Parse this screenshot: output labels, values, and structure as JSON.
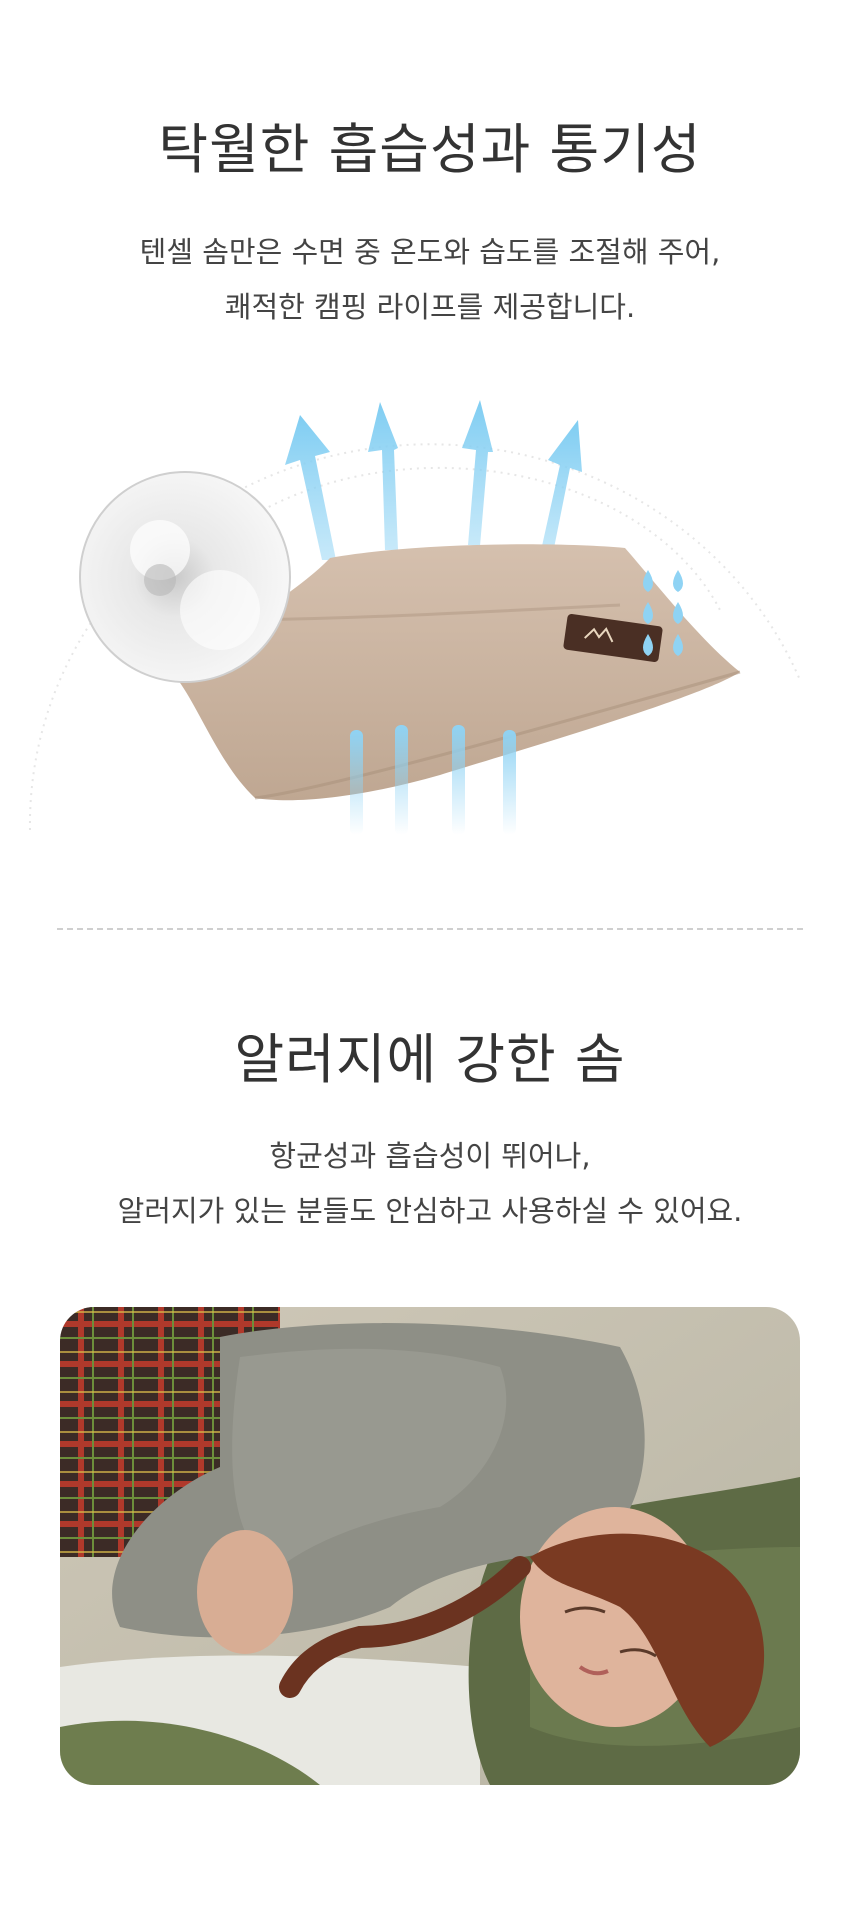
{
  "sections": [
    {
      "title": "탁월한 흡습성과 통기성",
      "desc_line1": "텐셀 솜만은 수면 중 온도와 습도를 조절해 주어,",
      "desc_line2": "쾌적한 캠핑 라이프를 제공합니다."
    },
    {
      "title": "알러지에 강한 솜",
      "desc_line1": "항균성과 흡습성이 뛰어나,",
      "desc_line2": "알러지가 있는 분들도 안심하고 사용하실 수 있어요."
    }
  ],
  "colors": {
    "arrow": "#8fd3f4",
    "pillow": "#c9b29f",
    "pillow_patch": "#4a2f24",
    "background": "#ffffff"
  }
}
